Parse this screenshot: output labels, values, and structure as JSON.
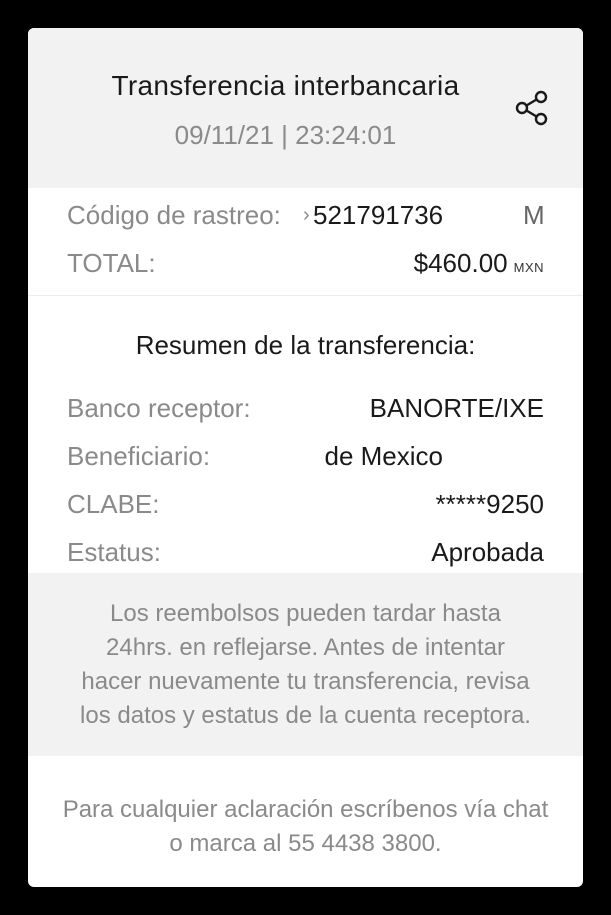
{
  "header": {
    "title": "Transferencia interbancaria",
    "datetime": "09/11/21 | 23:24:01",
    "share_icon": "share-icon"
  },
  "tracking": {
    "label": "Código de rastreo:",
    "prefix": "›",
    "value": "521791736",
    "trailing": "M"
  },
  "total": {
    "label": "TOTAL:",
    "amount": "$460.00",
    "currency": "MXN"
  },
  "summary": {
    "title": "Resumen de la transferencia:",
    "rows": [
      {
        "label": "Banco receptor:",
        "value": "BANORTE/IXE"
      },
      {
        "label": "Beneficiario:",
        "value": "de Mexico"
      },
      {
        "label": "CLABE:",
        "value": "*****9250"
      },
      {
        "label": "Estatus:",
        "value": "Aprobada"
      }
    ]
  },
  "notice": {
    "lines": [
      "Los reembolsos pueden tardar hasta",
      "24hrs. en reflejarse. Antes de intentar",
      "hacer nuevamente tu transferencia, revisa",
      "los datos y estatus de la cuenta receptora."
    ]
  },
  "footer": {
    "lines": [
      "Para cualquier aclaración escríbenos vía chat",
      "o marca al 55 4438 3800."
    ]
  },
  "colors": {
    "background": "#000000",
    "card": "#ffffff",
    "panel": "#f2f2f2",
    "label": "#8a8a8a",
    "value": "#1a1a1a"
  }
}
